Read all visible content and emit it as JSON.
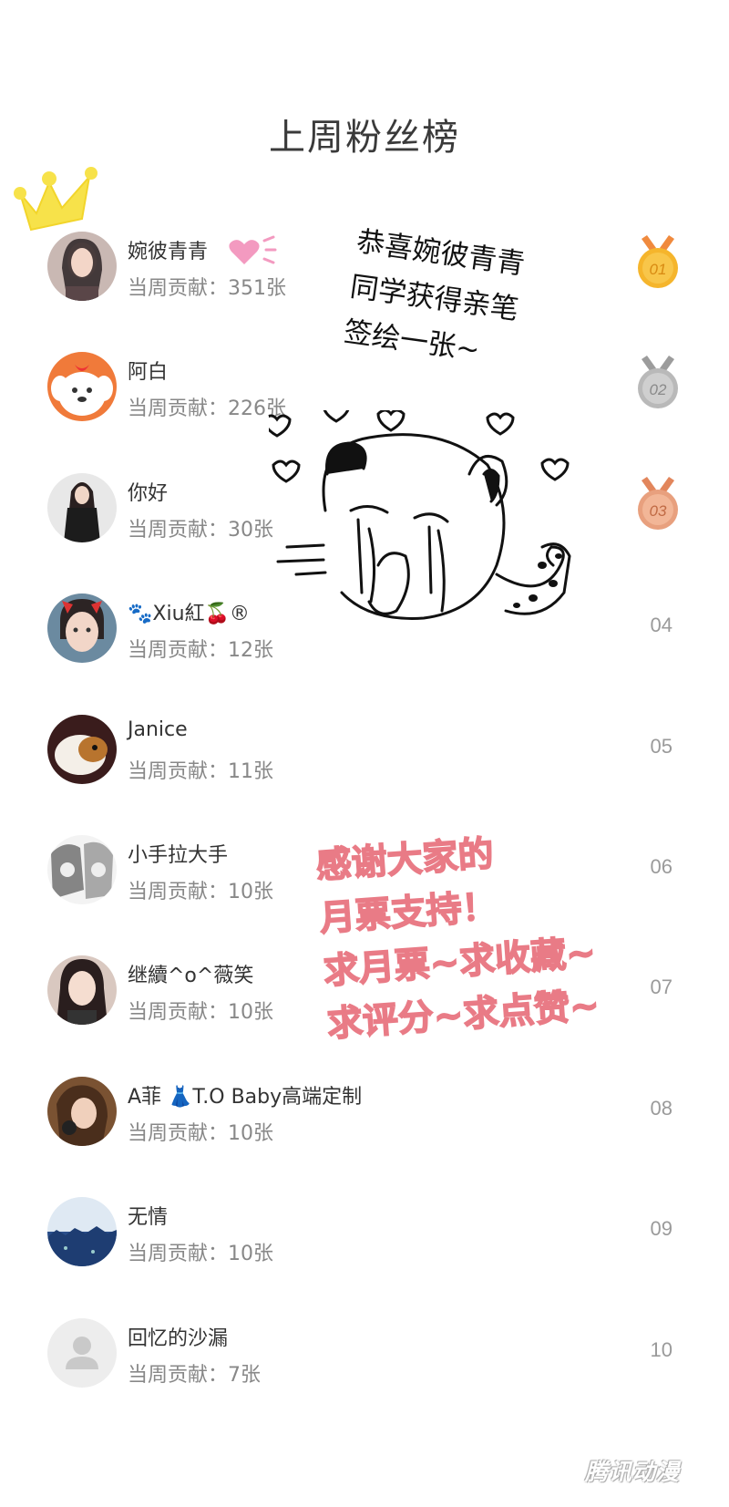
{
  "title": "上周粉丝榜",
  "speech_bubble": [
    "恭喜婉彼青青",
    "同学获得亲笔",
    "签绘一张~"
  ],
  "thanks_note": [
    "感谢大家的",
    "月票支持！",
    "求月票~求收藏~",
    "求评分~求点赞~"
  ],
  "watermark": "腾讯动漫",
  "colors": {
    "gold": "#f5b52c",
    "silver": "#b9b9b9",
    "bronze": "#e8a07e",
    "pink_text": "#e97b86",
    "crown": "#f7e24a"
  },
  "fans": [
    {
      "name": "婉彼青青",
      "contribution": "当周贡献：351张",
      "rank": "01",
      "medal": "gold"
    },
    {
      "name": "阿白",
      "contribution": "当周贡献：226张",
      "rank": "02",
      "medal": "silver"
    },
    {
      "name": "你好",
      "contribution": "当周贡献：30张",
      "rank": "03",
      "medal": "bronze"
    },
    {
      "name": "🐾Xiu紅🍒®",
      "contribution": "当周贡献：12张",
      "rank": "04"
    },
    {
      "name": "Janice",
      "contribution": "当周贡献：11张",
      "rank": "05"
    },
    {
      "name": "小手拉大手",
      "contribution": "当周贡献：10张",
      "rank": "06"
    },
    {
      "name": "继續^o^薇笑",
      "contribution": "当周贡献：10张",
      "rank": "07"
    },
    {
      "name": "A菲 👗T.O Baby高端定制",
      "contribution": "当周贡献：10张",
      "rank": "08"
    },
    {
      "name": "无情",
      "contribution": "当周贡献：10张",
      "rank": "09"
    },
    {
      "name": "回忆的沙漏",
      "contribution": "当周贡献：7张",
      "rank": "10"
    }
  ]
}
